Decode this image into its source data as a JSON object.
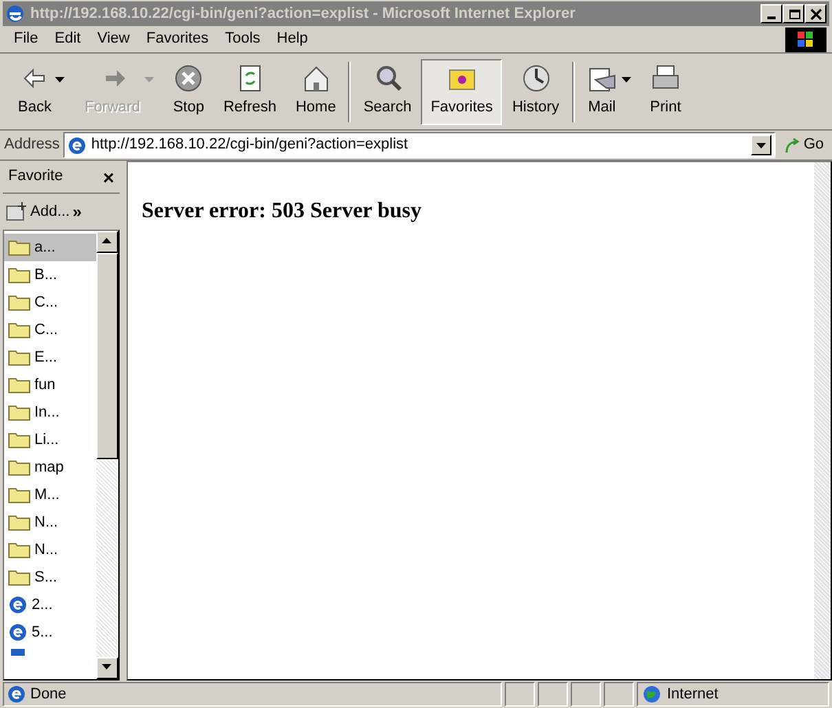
{
  "window": {
    "title": "http://192.168.10.22/cgi-bin/geni?action=explist - Microsoft Internet Explorer"
  },
  "menu": [
    {
      "label": "File"
    },
    {
      "label": "Edit"
    },
    {
      "label": "View"
    },
    {
      "label": "Favorites"
    },
    {
      "label": "Tools"
    },
    {
      "label": "Help"
    }
  ],
  "toolbar": [
    {
      "kind": "back",
      "label": "Back",
      "disabled": false,
      "selected": false,
      "dropdown": true
    },
    {
      "kind": "forward",
      "label": "Forward",
      "disabled": true,
      "selected": false,
      "dropdown": true
    },
    {
      "kind": "stop",
      "label": "Stop",
      "disabled": false,
      "selected": false,
      "dropdown": false
    },
    {
      "kind": "refresh",
      "label": "Refresh",
      "disabled": false,
      "selected": false,
      "dropdown": false
    },
    {
      "kind": "home",
      "label": "Home",
      "disabled": false,
      "selected": false,
      "dropdown": false
    },
    {
      "kind": "search",
      "label": "Search",
      "disabled": false,
      "selected": false,
      "dropdown": false
    },
    {
      "kind": "favorites",
      "label": "Favorites",
      "disabled": false,
      "selected": true,
      "dropdown": false
    },
    {
      "kind": "history",
      "label": "History",
      "disabled": false,
      "selected": false,
      "dropdown": false
    },
    {
      "kind": "mail",
      "label": "Mail",
      "disabled": false,
      "selected": false,
      "dropdown": true
    },
    {
      "kind": "print",
      "label": "Print",
      "disabled": false,
      "selected": false,
      "dropdown": false
    }
  ],
  "address": {
    "label": "Address",
    "value": "http://192.168.10.22/cgi-bin/geni?action=explist",
    "go": "Go"
  },
  "sidebar": {
    "title": "Favorite",
    "close": "×",
    "add": "Add...",
    "more": "»",
    "items": [
      {
        "kind": "folder",
        "label": "a...",
        "selected": true
      },
      {
        "kind": "folder",
        "label": "B...",
        "selected": false
      },
      {
        "kind": "folder",
        "label": "C...",
        "selected": false
      },
      {
        "kind": "folder",
        "label": "C...",
        "selected": false
      },
      {
        "kind": "folder",
        "label": "E...",
        "selected": false
      },
      {
        "kind": "folder",
        "label": "fun",
        "selected": false
      },
      {
        "kind": "folder",
        "label": "In...",
        "selected": false
      },
      {
        "kind": "folder",
        "label": "Li...",
        "selected": false
      },
      {
        "kind": "folder",
        "label": "map",
        "selected": false
      },
      {
        "kind": "folder",
        "label": "M...",
        "selected": false
      },
      {
        "kind": "folder",
        "label": "N...",
        "selected": false
      },
      {
        "kind": "folder",
        "label": "N...",
        "selected": false
      },
      {
        "kind": "folder",
        "label": "S...",
        "selected": false
      },
      {
        "kind": "page",
        "label": "2...",
        "selected": false
      },
      {
        "kind": "page",
        "label": "5...",
        "selected": false
      }
    ]
  },
  "content": {
    "heading": "Server error: 503 Server busy"
  },
  "status_bar": {
    "text": "Done",
    "zone": "Internet"
  }
}
